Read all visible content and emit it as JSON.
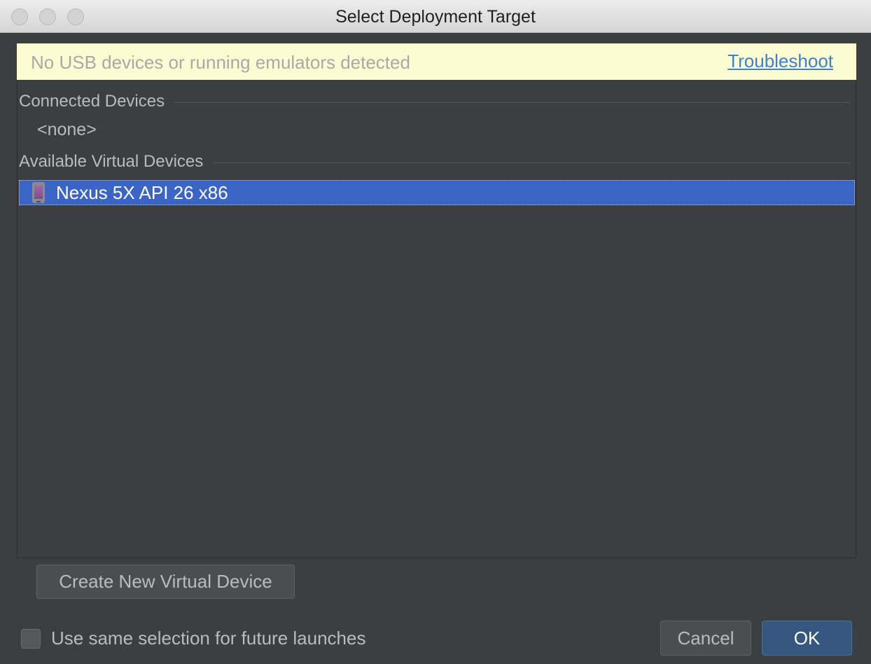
{
  "window": {
    "title": "Select Deployment Target",
    "controls": [
      "close-button",
      "minimize-button",
      "zoom-button"
    ]
  },
  "banner": {
    "message": "No USB devices or running emulators detected",
    "link_label": "Troubleshoot",
    "background": "#fdfbd1",
    "link_color": "#3b80d6"
  },
  "connected_devices": {
    "header": "Connected Devices",
    "empty_text": "<none>"
  },
  "available_virtual_devices": {
    "header": "Available Virtual Devices",
    "items": [
      {
        "name": "Nexus 5X API 26 x86",
        "icon": "phone-icon",
        "selected": true
      }
    ]
  },
  "buttons": {
    "create": "Create New Virtual Device",
    "cancel": "Cancel",
    "ok": "OK"
  },
  "checkbox": {
    "label": "Use same selection for future launches",
    "checked": false
  },
  "colors": {
    "dialog_background": "#3c3f41",
    "selection": "#3a65c6",
    "ok_button": "#365880"
  }
}
